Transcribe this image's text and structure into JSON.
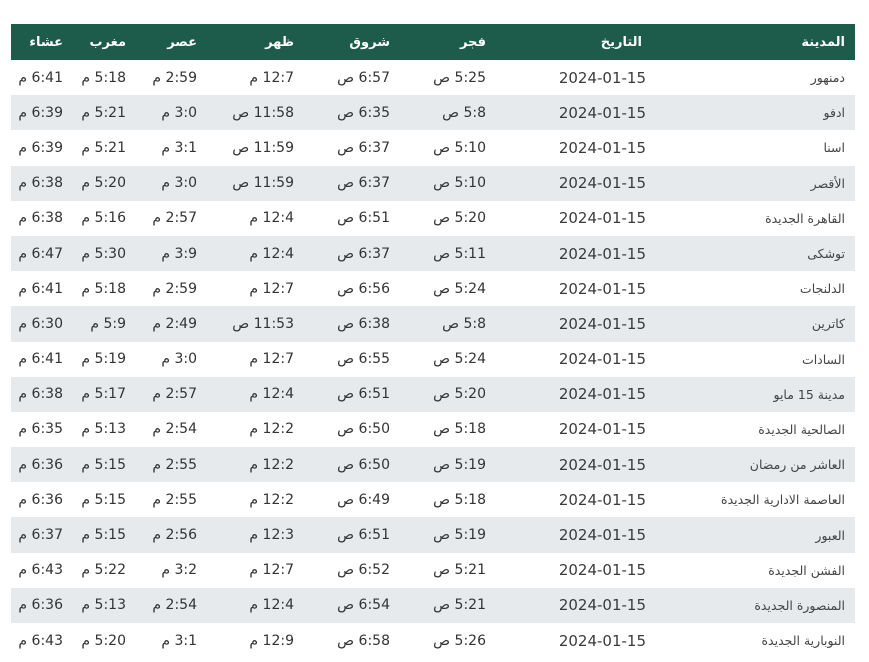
{
  "headers": {
    "city": "المدينة",
    "date": "التاريخ",
    "fajr": "فجر",
    "shuruq": "شروق",
    "dhuhr": "ظهر",
    "asr": "عصر",
    "maghrib": "مغرب",
    "isha": "عشاء"
  },
  "rows": [
    {
      "city": "دمنهور",
      "date": "2024-01-15",
      "fajr": "5:25 ص",
      "shuruq": "6:57 ص",
      "dhuhr": "12:7 م",
      "asr": "2:59 م",
      "maghrib": "5:18 م",
      "isha": "6:41 م"
    },
    {
      "city": "ادفو",
      "date": "2024-01-15",
      "fajr": "5:8 ص",
      "shuruq": "6:35 ص",
      "dhuhr": "11:58 ص",
      "asr": "3:0 م",
      "maghrib": "5:21 م",
      "isha": "6:39 م"
    },
    {
      "city": "اسنا",
      "date": "2024-01-15",
      "fajr": "5:10 ص",
      "shuruq": "6:37 ص",
      "dhuhr": "11:59 ص",
      "asr": "3:1 م",
      "maghrib": "5:21 م",
      "isha": "6:39 م"
    },
    {
      "city": "الأقصر",
      "date": "2024-01-15",
      "fajr": "5:10 ص",
      "shuruq": "6:37 ص",
      "dhuhr": "11:59 ص",
      "asr": "3:0 م",
      "maghrib": "5:20 م",
      "isha": "6:38 م"
    },
    {
      "city": "القاهرة الجديدة",
      "date": "2024-01-15",
      "fajr": "5:20 ص",
      "shuruq": "6:51 ص",
      "dhuhr": "12:4 م",
      "asr": "2:57 م",
      "maghrib": "5:16 م",
      "isha": "6:38 م"
    },
    {
      "city": "توشكى",
      "date": "2024-01-15",
      "fajr": "5:11 ص",
      "shuruq": "6:37 ص",
      "dhuhr": "12:4 م",
      "asr": "3:9 م",
      "maghrib": "5:30 م",
      "isha": "6:47 م"
    },
    {
      "city": "الدلنجات",
      "date": "2024-01-15",
      "fajr": "5:24 ص",
      "shuruq": "6:56 ص",
      "dhuhr": "12:7 م",
      "asr": "2:59 م",
      "maghrib": "5:18 م",
      "isha": "6:41 م"
    },
    {
      "city": "كاترين",
      "date": "2024-01-15",
      "fajr": "5:8 ص",
      "shuruq": "6:38 ص",
      "dhuhr": "11:53 ص",
      "asr": "2:49 م",
      "maghrib": "5:9 م",
      "isha": "6:30 م"
    },
    {
      "city": "السادات",
      "date": "2024-01-15",
      "fajr": "5:24 ص",
      "shuruq": "6:55 ص",
      "dhuhr": "12:7 م",
      "asr": "3:0 م",
      "maghrib": "5:19 م",
      "isha": "6:41 م"
    },
    {
      "city": "مدينة 15 مايو",
      "date": "2024-01-15",
      "fajr": "5:20 ص",
      "shuruq": "6:51 ص",
      "dhuhr": "12:4 م",
      "asr": "2:57 م",
      "maghrib": "5:17 م",
      "isha": "6:38 م"
    },
    {
      "city": "الصالحية الجديدة",
      "date": "2024-01-15",
      "fajr": "5:18 ص",
      "shuruq": "6:50 ص",
      "dhuhr": "12:2 م",
      "asr": "2:54 م",
      "maghrib": "5:13 م",
      "isha": "6:35 م"
    },
    {
      "city": "العاشر من رمضان",
      "date": "2024-01-15",
      "fajr": "5:19 ص",
      "shuruq": "6:50 ص",
      "dhuhr": "12:2 م",
      "asr": "2:55 م",
      "maghrib": "5:15 م",
      "isha": "6:36 م"
    },
    {
      "city": "العاصمة الادارية الجديدة",
      "date": "2024-01-15",
      "fajr": "5:18 ص",
      "shuruq": "6:49 ص",
      "dhuhr": "12:2 م",
      "asr": "2:55 م",
      "maghrib": "5:15 م",
      "isha": "6:36 م"
    },
    {
      "city": "العبور",
      "date": "2024-01-15",
      "fajr": "5:19 ص",
      "shuruq": "6:51 ص",
      "dhuhr": "12:3 م",
      "asr": "2:56 م",
      "maghrib": "5:15 م",
      "isha": "6:37 م"
    },
    {
      "city": "الفشن الجديدة",
      "date": "2024-01-15",
      "fajr": "5:21 ص",
      "shuruq": "6:52 ص",
      "dhuhr": "12:7 م",
      "asr": "3:2 م",
      "maghrib": "5:22 م",
      "isha": "6:43 م"
    },
    {
      "city": "المنصورة الجديدة",
      "date": "2024-01-15",
      "fajr": "5:21 ص",
      "shuruq": "6:54 ص",
      "dhuhr": "12:4 م",
      "asr": "2:54 م",
      "maghrib": "5:13 م",
      "isha": "6:36 م"
    },
    {
      "city": "النوبارية الجديدة",
      "date": "2024-01-15",
      "fajr": "5:26 ص",
      "shuruq": "6:58 ص",
      "dhuhr": "12:9 م",
      "asr": "3:1 م",
      "maghrib": "5:20 م",
      "isha": "6:43 م"
    }
  ]
}
